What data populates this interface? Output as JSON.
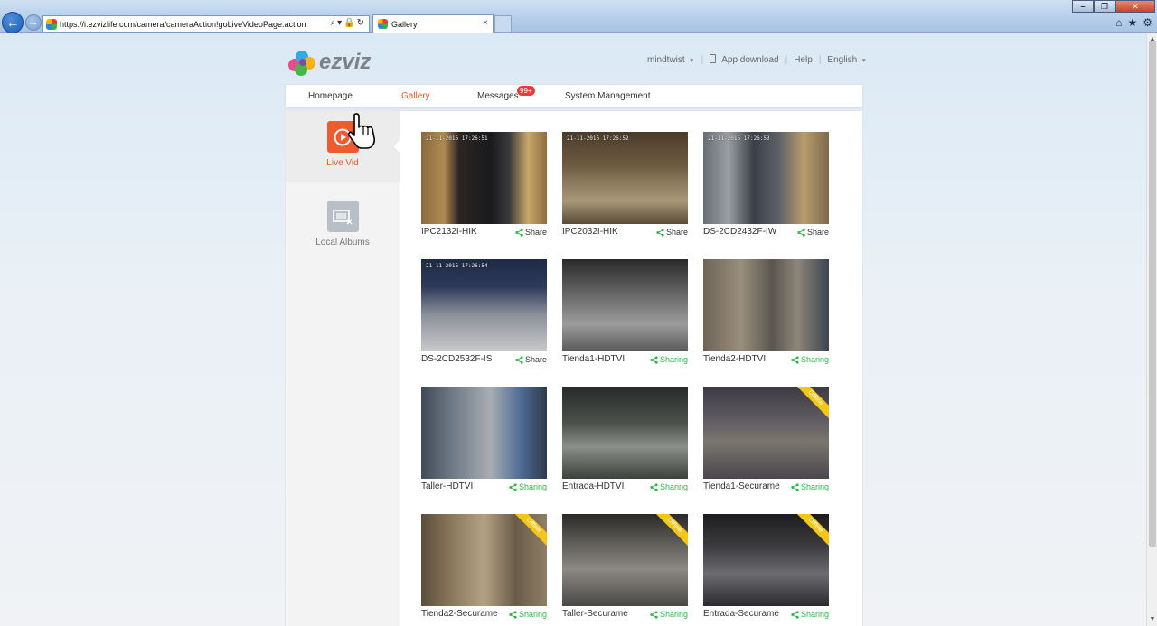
{
  "browser": {
    "url": "https://i.ezvizlife.com/camera/cameraAction!goLiveVideoPage.action",
    "tab_title": "Gallery",
    "tab_close": "×"
  },
  "header": {
    "brand": "ezviz",
    "user": "mindtwist",
    "app_download": "App download",
    "help": "Help",
    "language": "English"
  },
  "nav": {
    "items": [
      {
        "label": "Homepage",
        "active": false
      },
      {
        "label": "Gallery",
        "active": true
      },
      {
        "label": "Messages",
        "active": false,
        "badge": "99+"
      },
      {
        "label": "System Management",
        "active": false
      }
    ]
  },
  "sidebar": {
    "live_video": "Live Vid",
    "local_albums": "Local Albums"
  },
  "cameras": [
    {
      "name": "IPC2132I-HIK",
      "share": "Share",
      "style": "plain",
      "offline": false,
      "stamp": "21-11-2016 17:26:51",
      "scene": 0
    },
    {
      "name": "IPC2032I-HIK",
      "share": "Share",
      "style": "plain",
      "offline": false,
      "stamp": "21-11-2016 17:26:52",
      "scene": 1
    },
    {
      "name": "DS-2CD2432F-IW",
      "share": "Share",
      "style": "plain",
      "offline": false,
      "stamp": "21-11-2016 17:26:53",
      "scene": 2
    },
    {
      "name": "DS-2CD2532F-IS",
      "share": "Share",
      "style": "plain",
      "offline": false,
      "stamp": "21-11-2016 17:26:54",
      "scene": 3
    },
    {
      "name": "Tienda1-HDTVI",
      "share": "Sharing",
      "style": "green",
      "offline": false,
      "stamp": "",
      "scene": 4
    },
    {
      "name": "Tienda2-HDTVI",
      "share": "Sharing",
      "style": "green",
      "offline": false,
      "stamp": "",
      "scene": 5
    },
    {
      "name": "Taller-HDTVI",
      "share": "Sharing",
      "style": "green",
      "offline": false,
      "stamp": "",
      "scene": 6
    },
    {
      "name": "Entrada-HDTVI",
      "share": "Sharing",
      "style": "green",
      "offline": false,
      "stamp": "",
      "scene": 7
    },
    {
      "name": "Tienda1-Securame",
      "share": "Sharing",
      "style": "green",
      "offline": true,
      "stamp": "",
      "scene": 8
    },
    {
      "name": "Tienda2-Securame",
      "share": "Sharing",
      "style": "green",
      "offline": true,
      "stamp": "",
      "scene": 9
    },
    {
      "name": "Taller-Securame",
      "share": "Sharing",
      "style": "green",
      "offline": true,
      "stamp": "",
      "scene": 10
    },
    {
      "name": "Entrada-Securame",
      "share": "Sharing",
      "style": "green",
      "offline": true,
      "stamp": "",
      "scene": 11
    }
  ],
  "offline_label": "Offline",
  "colors": {
    "accent": "#ef5a2e",
    "sharing_green": "#34b34a",
    "offline_ribbon": "#f5c518",
    "badge_red": "#ee3a3a"
  }
}
